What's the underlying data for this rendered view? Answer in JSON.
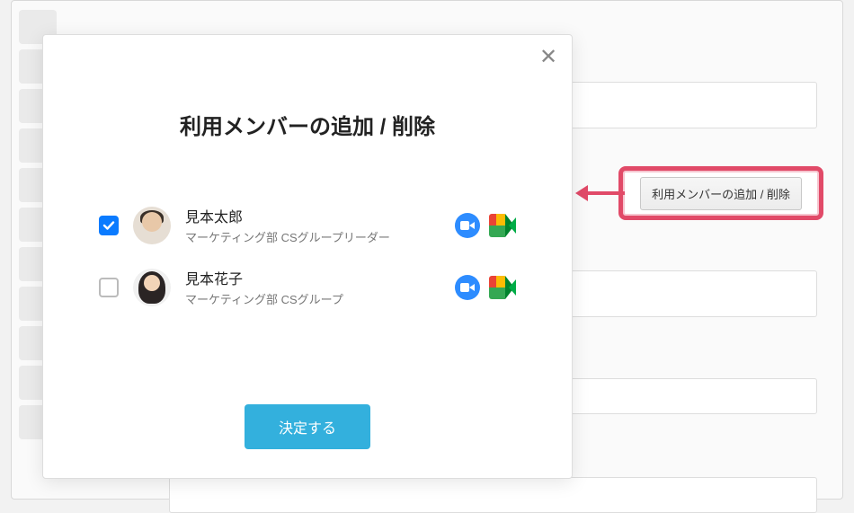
{
  "modal": {
    "title": "利用メンバーの追加 / 削除",
    "submit_label": "決定する"
  },
  "members": [
    {
      "name": "見本太郎",
      "role": "マーケティング部 CSグループリーダー",
      "checked": true,
      "avatar_kind": "m"
    },
    {
      "name": "見本花子",
      "role": "マーケティング部 CSグループ",
      "checked": false,
      "avatar_kind": "f"
    }
  ],
  "callout_button_label": "利用メンバーの追加 / 削除",
  "colors": {
    "accent": "#33b0dd",
    "callout_border": "#e14a68",
    "checkbox_checked": "#0a7bff"
  }
}
